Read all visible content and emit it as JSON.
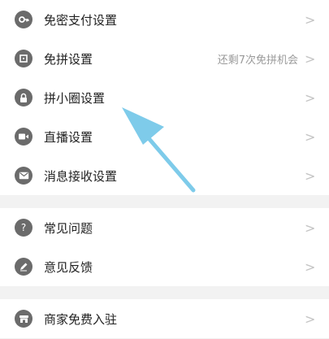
{
  "menu": {
    "groups": [
      {
        "items": [
          {
            "label": "免密支付设置",
            "value": "",
            "icon": "key-icon"
          },
          {
            "label": "免拼设置",
            "value": "还剩7次免拼机会",
            "icon": "coupon-icon"
          },
          {
            "label": "拼小圈设置",
            "value": "",
            "icon": "lock-icon"
          },
          {
            "label": "直播设置",
            "value": "",
            "icon": "video-icon"
          },
          {
            "label": "消息接收设置",
            "value": "",
            "icon": "mail-icon"
          }
        ]
      },
      {
        "items": [
          {
            "label": "常见问题",
            "value": "",
            "icon": "question-icon"
          },
          {
            "label": "意见反馈",
            "value": "",
            "icon": "pencil-icon"
          }
        ]
      },
      {
        "items": [
          {
            "label": "商家免费入驻",
            "value": "",
            "icon": "store-icon"
          }
        ]
      }
    ]
  },
  "annotation": {
    "color": "#7ecbea",
    "icon": "pointer-arrow"
  }
}
